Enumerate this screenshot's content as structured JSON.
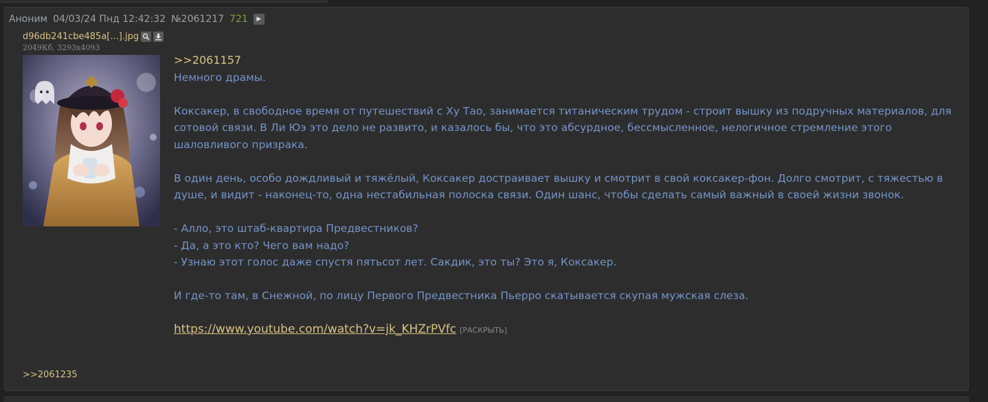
{
  "post": {
    "name": "Аноним",
    "date": "04/03/24 Пнд 12:42:32",
    "number": "№2061217",
    "count": "721",
    "play_icon": "play-icon",
    "file": {
      "name": "d96db241cbe485a[...].jpg",
      "meta": "2049Кб, 3293x4093",
      "search_icon": "search-icon",
      "download_icon": "download-icon"
    },
    "body": {
      "reply_ref": ">>2061157",
      "lines": [
        "Немного драмы.",
        "Коксакер, в свободное время от путешествий с Ху Тао, занимается титаническим трудом - строит вышку из подручных материалов, для сотовой связи. В Ли Юэ это дело не развито, и казалось бы, что это абсурдное, бессмысленное, нелогичное стремление этого шаловливого призрака.",
        "В один день, особо дождливый и тяжёлый, Коксакер достраивает вышку и смотрит в свой коксакер-фон. Долго смотрит, с тяжестью в душе, и видит - наконец-то, одна нестабильная полоска связи. Один шанс, чтобы сделать самый важный в своей жизни звонок.",
        "- Алло, это штаб-квартира Предвестников?",
        "- Да, а это кто? Чего вам надо?",
        "- Узнаю этот голос даже спустя пятьсот лет. Сакдик, это ты? Это я, Коксакер.",
        "И где-то там, в Снежной, по лицу Первого Предвестника Пьерро скатывается скупая мужская слеза."
      ],
      "url": "https://www.youtube.com/watch?v=jk_KHZrPVfc",
      "expand_label": "[РАСКРЫТЬ]"
    },
    "backlinks": [
      ">>2061235"
    ]
  }
}
